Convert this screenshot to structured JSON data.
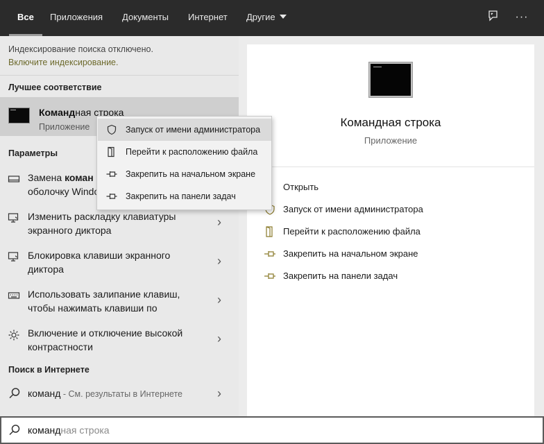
{
  "tabs": [
    {
      "label": "Все"
    },
    {
      "label": "Приложения"
    },
    {
      "label": "Документы"
    },
    {
      "label": "Интернет"
    },
    {
      "label": "Другие"
    }
  ],
  "top_icons": {
    "feedback": "feedback-icon",
    "more": "more-icon",
    "more_glyph": "···"
  },
  "notice": {
    "text": "Индексирование поиска отключено.",
    "link": "Включите индексирование."
  },
  "best_match": {
    "section_title": "Лучшее соответствие",
    "title_bold": "Команд",
    "title_rest": "ная строка",
    "subtitle": "Приложение"
  },
  "settings": {
    "section_title": "Параметры",
    "items": [
      {
        "line1_a": "Замена ",
        "line1_b": "коман",
        "line2": "оболочку Windo",
        "icon": "monitor-icon"
      },
      {
        "line1": "Изменить раскладку клавиатуры",
        "line2": "экранного диктора",
        "icon": "narrator-icon"
      },
      {
        "line1": "Блокировка клавиши экранного",
        "line2": "диктора",
        "icon": "narrator-icon"
      },
      {
        "line1": "Использовать залипание клавиш,",
        "line2": "чтобы нажимать клавиши по",
        "icon": "keyboard-icon"
      },
      {
        "line1": "Включение и отключение высокой",
        "line2": "контрастности",
        "icon": "brightness-icon"
      }
    ]
  },
  "web": {
    "section_title": "Поиск в Интернете",
    "query": "команд",
    "suffix": " - См. результаты в Интернете"
  },
  "preview": {
    "title": "Командная строка",
    "subtitle": "Приложение",
    "actions": [
      {
        "label": "Открыть",
        "icon": "open-icon"
      },
      {
        "label": "Запуск от имени администратора",
        "icon": "shield-icon"
      },
      {
        "label": "Перейти к расположению файла",
        "icon": "file-location-icon"
      },
      {
        "label": "Закрепить на начальном экране",
        "icon": "pin-icon"
      },
      {
        "label": "Закрепить на панели задач",
        "icon": "pin-icon"
      }
    ]
  },
  "context_menu": {
    "items": [
      {
        "label": "Запуск от имени администратора",
        "icon": "shield-icon"
      },
      {
        "label": "Перейти к расположению файла",
        "icon": "file-location-icon"
      },
      {
        "label": "Закрепить на начальном экране",
        "icon": "pin-icon"
      },
      {
        "label": "Закрепить на панели задач",
        "icon": "pin-icon"
      }
    ]
  },
  "search": {
    "typed": "команд",
    "hint": "ная строка"
  },
  "colors": {
    "topbar": "#2b2b2b",
    "link": "#6d6a2c",
    "selected_row": "#cfcfcf"
  }
}
